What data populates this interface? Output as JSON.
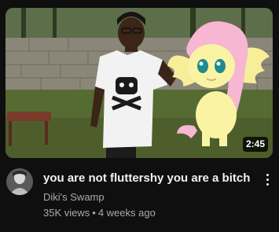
{
  "video": {
    "duration": "2:45",
    "title": "you are not fluttershy you are a bitch",
    "channel": "Diki's Swamp",
    "views": "35K views",
    "separator": "•",
    "age": "4 weeks ago"
  },
  "icons": {
    "more_actions": "vertical-ellipsis-icon"
  },
  "colors": {
    "background": "#0f0f0f",
    "title_text": "#f1f1f1",
    "secondary_text": "#aaaaaa",
    "duration_badge": "#000000"
  }
}
